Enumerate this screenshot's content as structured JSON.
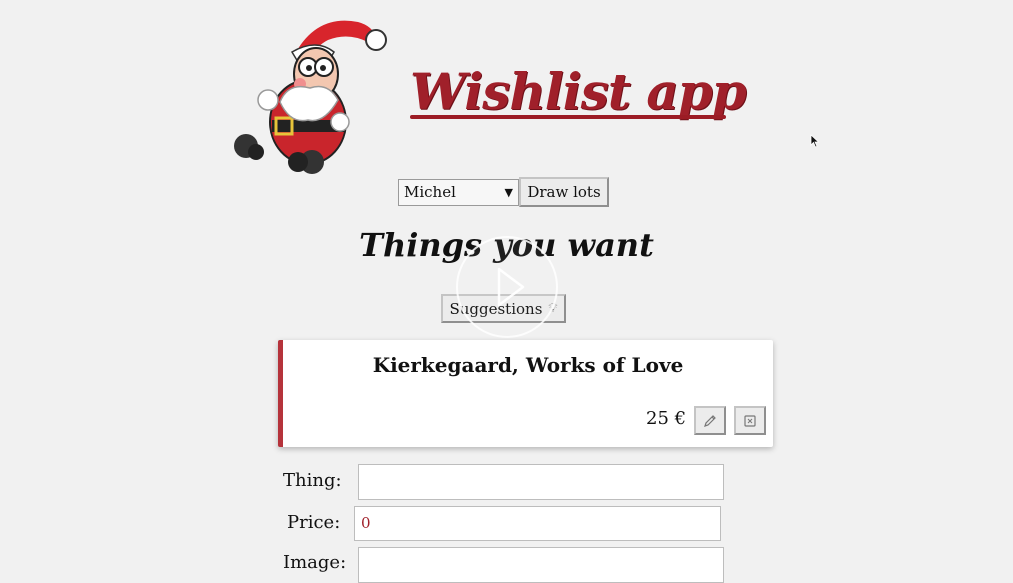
{
  "header": {
    "title": "Wishlist app",
    "logo_icon": "santa-claus-icon"
  },
  "controls": {
    "person_selected": "Michel",
    "draw_lots_label": "Draw lots"
  },
  "section": {
    "title": "Things you want",
    "suggestions_label": "Suggestions",
    "suggestions_icon": "lightbulb-icon"
  },
  "wish": {
    "title": "Kierkegaard, Works of Love",
    "price": "25 €",
    "edit_icon": "pencil-icon",
    "delete_icon": "trash-icon"
  },
  "form": {
    "thing_label": "Thing:",
    "thing_value": "",
    "price_label": "Price:",
    "price_value": "0",
    "image_label": "Image:",
    "image_value": ""
  },
  "colors": {
    "accent": "#a0202a",
    "background": "#f1f1f1",
    "card": "#ffffff"
  }
}
